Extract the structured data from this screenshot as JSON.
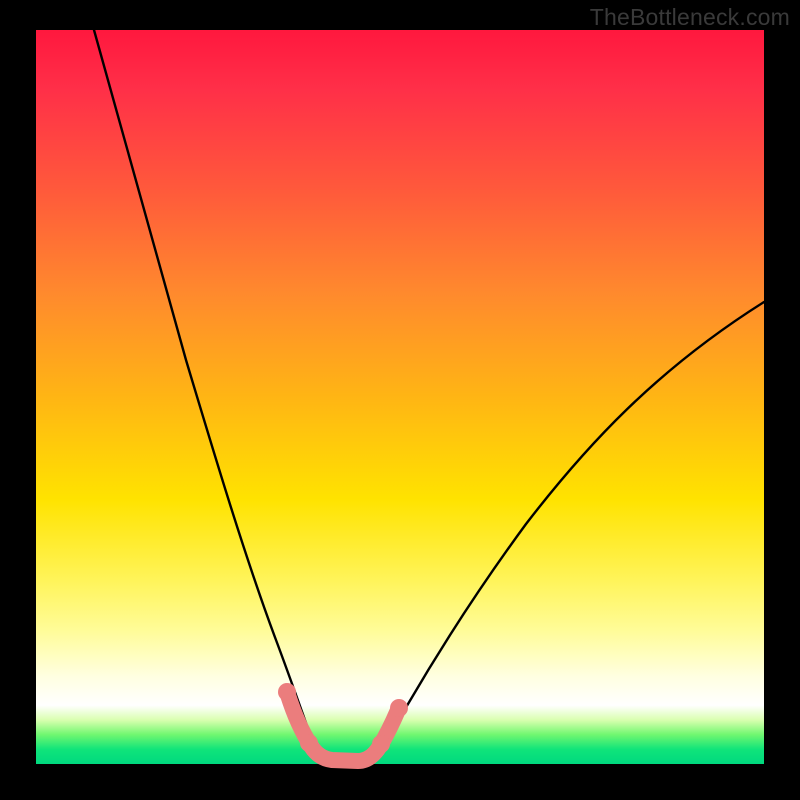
{
  "watermark": "TheBottleneck.com",
  "chart_data": {
    "type": "line",
    "title": "",
    "xlabel": "",
    "ylabel": "",
    "xlim": [
      0,
      100
    ],
    "ylim": [
      0,
      100
    ],
    "series": [
      {
        "name": "curve",
        "color": "#000000",
        "x": [
          8,
          12,
          16,
          20,
          24,
          28,
          30,
          32,
          34,
          35.5,
          37,
          39,
          41,
          43,
          45,
          47,
          50,
          55,
          62,
          70,
          80,
          90,
          100
        ],
        "y": [
          100,
          88,
          76,
          63,
          50,
          36,
          28,
          20,
          11,
          4,
          1,
          0,
          0,
          0,
          1,
          3,
          8,
          16,
          26,
          35,
          44,
          52,
          58
        ]
      },
      {
        "name": "highlight-band",
        "color": "#eb7d7d",
        "x": [
          34.5,
          36,
          38,
          40,
          42,
          44,
          45.5,
          47
        ],
        "y": [
          9,
          2,
          0,
          0,
          0,
          0,
          2,
          6
        ]
      }
    ],
    "colors": {
      "background_top": "#ff183e",
      "background_mid_orange": "#ff8a2d",
      "background_yellow": "#ffe300",
      "background_pale": "#ffffe0",
      "background_green": "#10e47a",
      "frame": "#000000",
      "highlight": "#eb7d7d"
    }
  }
}
